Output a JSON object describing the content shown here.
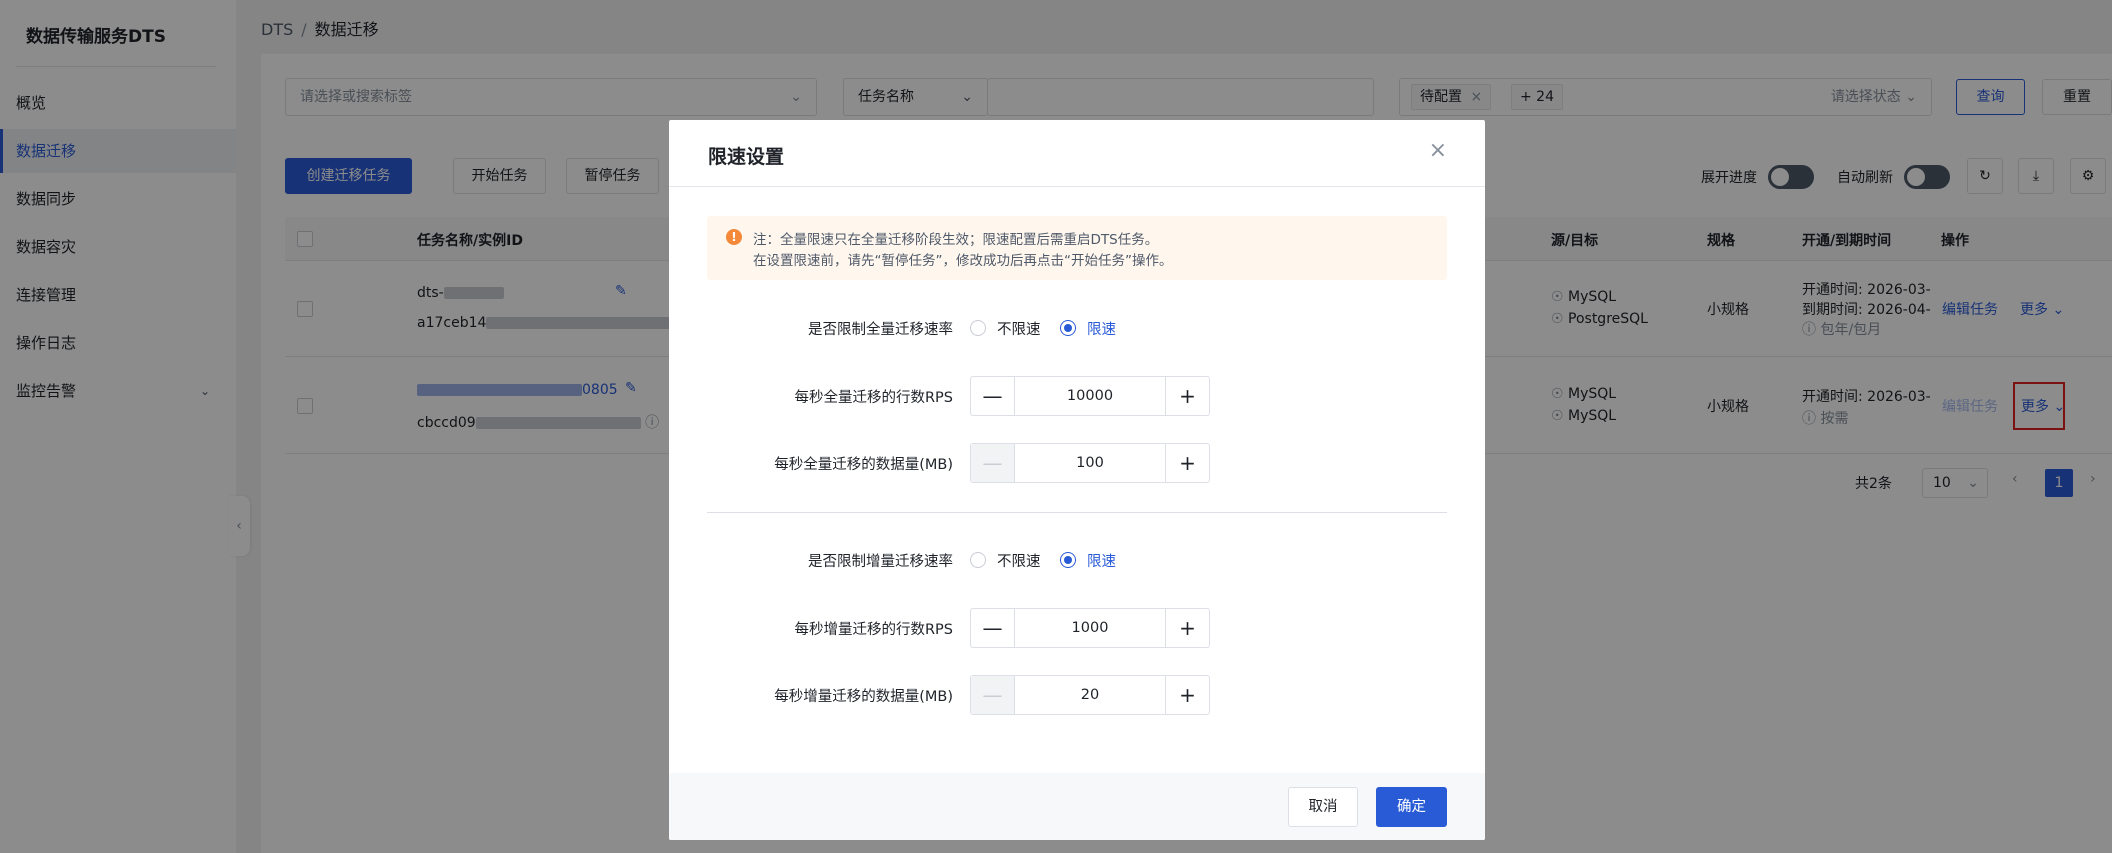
{
  "sidebar": {
    "title": "数据传输服务DTS",
    "items": [
      {
        "label": "概览"
      },
      {
        "label": "数据迁移"
      },
      {
        "label": "数据同步"
      },
      {
        "label": "数据容灾"
      },
      {
        "label": "连接管理"
      },
      {
        "label": "操作日志"
      },
      {
        "label": "监控告警"
      }
    ]
  },
  "breadcrumb": {
    "root": "DTS",
    "sep": "/",
    "current": "数据迁移"
  },
  "filters": {
    "tag_placeholder": "请选择或搜索标签",
    "field_select": "任务名称",
    "status_tag": "待配置",
    "status_more": "+ 24",
    "status_placeholder": "请选择状态",
    "query": "查询",
    "reset": "重置"
  },
  "toolbar": {
    "create": "创建迁移任务",
    "start": "开始任务",
    "pause": "暂停任务",
    "expand_progress": "展开进度",
    "auto_refresh": "自动刷新"
  },
  "table": {
    "headers": [
      "任务名称/实例ID",
      "源/目标",
      "规格",
      "开通/到期时间",
      "操作"
    ],
    "rows": [
      {
        "name": "dts-",
        "id": "a17ceb14",
        "src": "MySQL",
        "dst": "PostgreSQL",
        "spec": "小规格",
        "open": "开通时间: 2026-03-",
        "expire": "到期时间: 2026-04-",
        "billing": "包年/包月",
        "edit": "编辑任务",
        "more": "更多"
      },
      {
        "name": "0805",
        "id": "cbccd09",
        "src": "MySQL",
        "dst": "MySQL",
        "spec": "小规格",
        "open": "开通时间: 2026-03-",
        "billing": "按需",
        "edit": "编辑任务",
        "more": "更多"
      }
    ]
  },
  "pagination": {
    "total": "共2条",
    "page_size": "10",
    "page": "1"
  },
  "modal": {
    "title": "限速设置",
    "notice_line1": "注：全量限速只在全量迁移阶段生效；限速配置后需重启DTS任务。",
    "notice_line2": "在设置限速前，请先“暂停任务”，修改成功后再点击“开始任务”操作。",
    "full_limit_label": "是否限制全量迁移速率",
    "opt_no_limit": "不限速",
    "opt_limit": "限速",
    "full_rps_label": "每秒全量迁移的行数RPS",
    "full_rps_value": "10000",
    "full_mb_label": "每秒全量迁移的数据量(MB)",
    "full_mb_value": "100",
    "inc_limit_label": "是否限制增量迁移速率",
    "inc_rps_label": "每秒增量迁移的行数RPS",
    "inc_rps_value": "1000",
    "inc_mb_label": "每秒增量迁移的数据量(MB)",
    "inc_mb_value": "20",
    "cancel": "取消",
    "ok": "确定"
  },
  "colors": {
    "accent": "#2a5bd7",
    "warning": "#f5893a",
    "highlight": "#e02020"
  }
}
